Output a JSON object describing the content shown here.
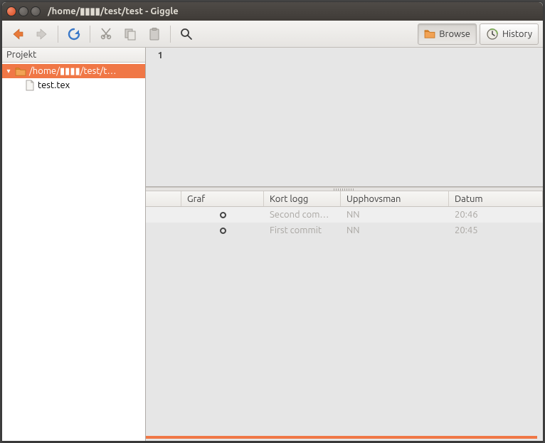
{
  "window": {
    "title": "/home/▮▮▮▮/test/test - Giggle"
  },
  "toolbar": {
    "browse_label": "Browse",
    "history_label": "History"
  },
  "sidebar": {
    "header": "Projekt",
    "items": [
      {
        "label": "/home/▮▮▮▮/test/t…",
        "type": "folder",
        "selected": true
      },
      {
        "label": "test.tex",
        "type": "file",
        "selected": false
      }
    ]
  },
  "editor": {
    "line_number": "1"
  },
  "log": {
    "columns": [
      "",
      "Graf",
      "Kort logg",
      "Upphovsman",
      "Datum"
    ],
    "rows": [
      {
        "short_log": "Second com…",
        "author": "NN",
        "date": "20:46"
      },
      {
        "short_log": "First commit",
        "author": "NN",
        "date": "20:45"
      }
    ]
  },
  "colors": {
    "accent": "#f07746"
  }
}
